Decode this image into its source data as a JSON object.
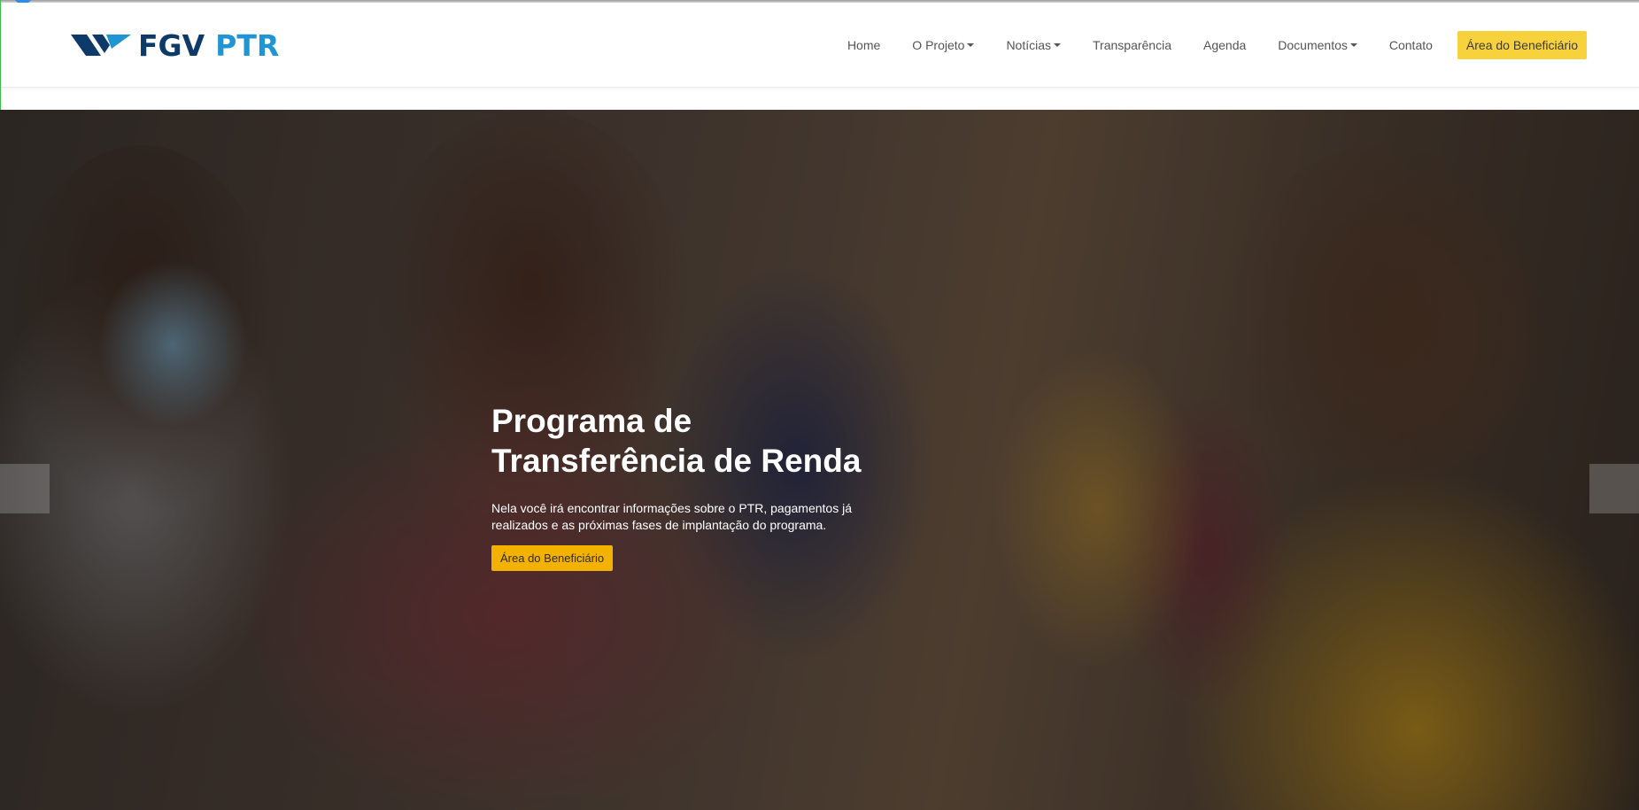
{
  "brand": {
    "name_part1": "FGV",
    "name_part2": "PTR",
    "logo_icon": "fgv-chevron-logo",
    "colors": {
      "dark_blue": "#0e3a69",
      "light_blue": "#2095d3"
    }
  },
  "nav": {
    "items": [
      {
        "label": "Home",
        "dropdown": false
      },
      {
        "label": "O Projeto",
        "dropdown": true
      },
      {
        "label": "Notícias",
        "dropdown": true
      },
      {
        "label": "Transparência",
        "dropdown": false
      },
      {
        "label": "Agenda",
        "dropdown": false
      },
      {
        "label": "Documentos",
        "dropdown": true
      },
      {
        "label": "Contato",
        "dropdown": false
      }
    ],
    "cta_label": "Área do Beneficiário",
    "cta_color": "#f8d23c"
  },
  "hero": {
    "title": "Programa de\nTransferência de Renda",
    "text": "Nela você irá encontrar informações sobre o PTR, pagamentos já realizados e as próximas fases de implantação do programa.",
    "button_label": "Área do Beneficiário",
    "button_color": "#f3b100",
    "prev_icon": "carousel-prev-control",
    "next_icon": "carousel-next-control"
  }
}
